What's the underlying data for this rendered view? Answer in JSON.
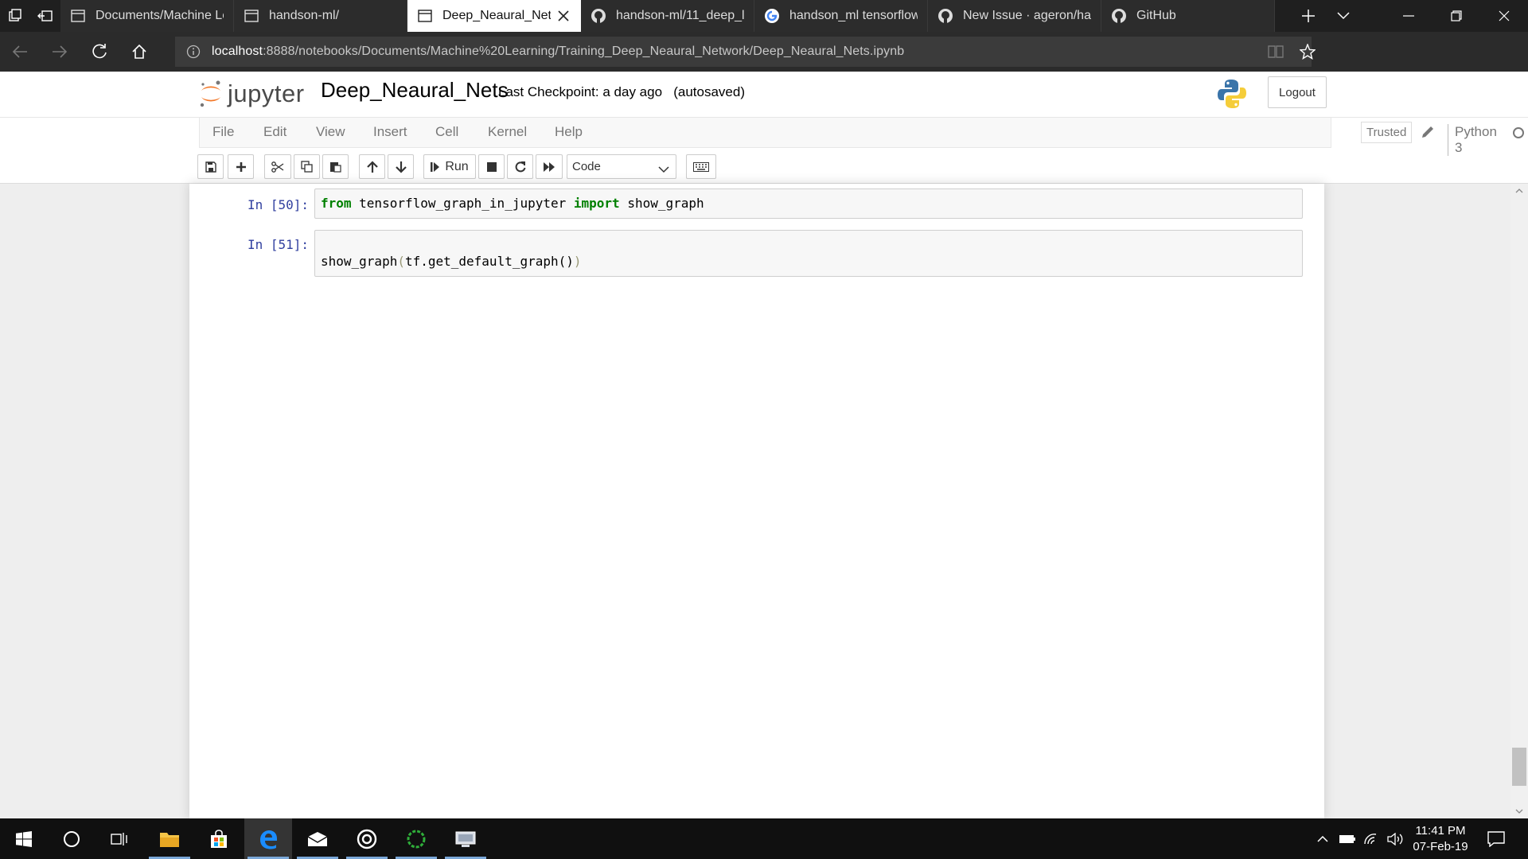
{
  "browser": {
    "tabs": [
      {
        "label": "Documents/Machine Le",
        "icon": "page-icon",
        "active": false
      },
      {
        "label": "handson-ml/",
        "icon": "page-icon",
        "active": false
      },
      {
        "label": "Deep_Neaural_Nets",
        "icon": "page-icon",
        "active": true
      },
      {
        "label": "handson-ml/11_deep_l",
        "icon": "github-icon",
        "active": false
      },
      {
        "label": "handson_ml tensorflow",
        "icon": "google-icon",
        "active": false
      },
      {
        "label": "New Issue · ageron/har",
        "icon": "github-icon",
        "active": false
      },
      {
        "label": "GitHub",
        "icon": "github-icon",
        "active": false
      }
    ],
    "url_host": "localhost",
    "url_rest": ":8888/notebooks/Documents/Machine%20Learning/Training_Deep_Neaural_Network/Deep_Neaural_Nets.ipynb"
  },
  "jupyter": {
    "logo_text": "jupyter",
    "notebook_name": "Deep_Neaural_Nets",
    "checkpoint": "Last Checkpoint: a day ago",
    "autosave": "(autosaved)",
    "logout_label": "Logout",
    "menu": [
      "File",
      "Edit",
      "View",
      "Insert",
      "Cell",
      "Kernel",
      "Help"
    ],
    "trusted_label": "Trusted",
    "kernel_name": "Python 3",
    "run_label": "Run",
    "cell_type": "Code"
  },
  "cells": [
    {
      "prompt": "In [50]:",
      "code": {
        "kw1": "from",
        "module": " tensorflow_graph_in_jupyter ",
        "kw2": "import",
        "name": " show_graph"
      }
    },
    {
      "prompt": "In [51]:",
      "code": {
        "fn": "show_graph",
        "open": "(",
        "arg": "tf.get_default_graph()",
        "close": ")"
      }
    }
  ],
  "taskbar": {
    "time": "11:41 PM",
    "date": "07-Feb-19"
  },
  "colors": {
    "prompt": "#303f9f",
    "keyword": "#008000",
    "jupyter_orange": "#f37726",
    "edge_blue": "#0078d7"
  }
}
